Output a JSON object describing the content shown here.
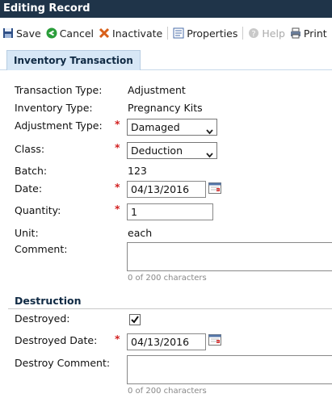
{
  "window": {
    "title": "Editing Record"
  },
  "toolbar": {
    "save": "Save",
    "cancel": "Cancel",
    "inactivate": "Inactivate",
    "properties": "Properties",
    "help": "Help",
    "print": "Print"
  },
  "tab": {
    "label": "Inventory Transaction"
  },
  "fields": {
    "transaction_type": {
      "label": "Transaction Type:",
      "value": "Adjustment"
    },
    "inventory_type": {
      "label": "Inventory Type:",
      "value": "Pregnancy Kits"
    },
    "adjustment_type": {
      "label": "Adjustment Type:",
      "value": "Damaged"
    },
    "class": {
      "label": "Class:",
      "value": "Deduction"
    },
    "batch": {
      "label": "Batch:",
      "value": "123"
    },
    "date": {
      "label": "Date:",
      "value": "04/13/2016"
    },
    "quantity": {
      "label": "Quantity:",
      "value": "1"
    },
    "unit": {
      "label": "Unit:",
      "value": "each"
    },
    "comment": {
      "label": "Comment:",
      "counter": "0 of 200 characters"
    }
  },
  "destruction": {
    "heading": "Destruction",
    "destroyed": {
      "label": "Destroyed:",
      "checked": true
    },
    "destroyed_date": {
      "label": "Destroyed Date:",
      "value": "04/13/2016"
    },
    "destroy_comment": {
      "label": "Destroy Comment:",
      "counter": "0 of 200 characters"
    }
  },
  "required_marker": "*",
  "colors": {
    "titlebar": "#1f3449",
    "required": "#d21f1f",
    "tab_bg": "#d7e7f6",
    "section": "#102a44"
  }
}
